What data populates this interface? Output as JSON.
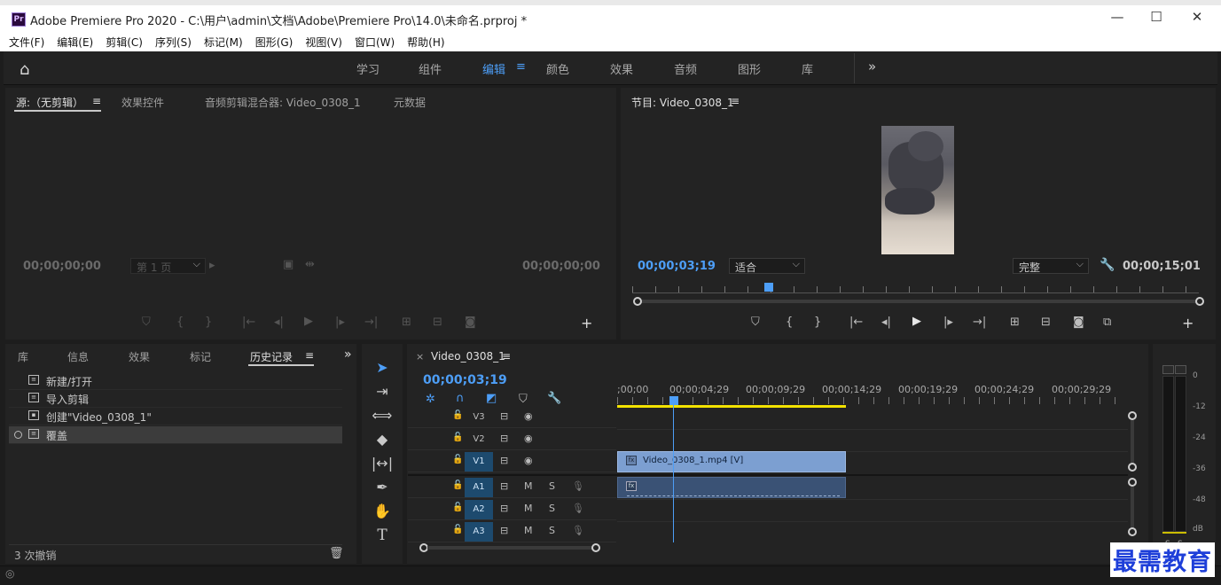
{
  "window": {
    "title": "Adobe Premiere Pro 2020 - C:\\用户\\admin\\文档\\Adobe\\Premiere Pro\\14.0\\未命名.prproj *",
    "app_icon": "Pr",
    "minimize": "—",
    "maximize": "☐",
    "close": "✕"
  },
  "menu": [
    "文件(F)",
    "编辑(E)",
    "剪辑(C)",
    "序列(S)",
    "标记(M)",
    "图形(G)",
    "视图(V)",
    "窗口(W)",
    "帮助(H)"
  ],
  "workspaces": {
    "tabs": [
      "学习",
      "组件",
      "编辑",
      "颜色",
      "效果",
      "音频",
      "图形",
      "库"
    ],
    "active": "编辑",
    "more": "»",
    "menu_glyph": "≡"
  },
  "source_panel": {
    "tabs": [
      "源:（无剪辑）",
      "效果控件",
      "音频剪辑混合器: Video_0308_1",
      "元数据"
    ],
    "menu_glyph": "≡",
    "tc_left": "00;00;00;00",
    "tc_right": "00;00;00;00",
    "page": "第 1 页"
  },
  "program_panel": {
    "title": "节目: Video_0308_1",
    "menu_glyph": "≡",
    "tc_current": "00;00;03;19",
    "fit": "适合",
    "quality": "完整",
    "tc_duration": "00;00;15;01"
  },
  "project_panel": {
    "tabs": [
      "库",
      "信息",
      "效果",
      "标记",
      "历史记录"
    ],
    "active": "历史记录",
    "menu_glyph": "≡",
    "more": "»",
    "history": [
      "新建/打开",
      "导入剪辑",
      "创建\"Video_0308_1\"",
      "覆盖"
    ],
    "undo_count": "3 次撤销"
  },
  "timeline": {
    "close": "×",
    "sequence": "Video_0308_1",
    "menu_glyph": "≡",
    "tc": "00;00;03;19",
    "ruler": [
      ";00;00",
      "00;00;04;29",
      "00;00;09;29",
      "00;00;14;29",
      "00;00;19;29",
      "00;00;24;29",
      "00;00;29;29"
    ],
    "tracks": [
      {
        "name": "V3",
        "type": "video",
        "targeted": false
      },
      {
        "name": "V2",
        "type": "video",
        "targeted": false
      },
      {
        "name": "V1",
        "type": "video",
        "targeted": true
      },
      {
        "name": "A1",
        "type": "audio",
        "targeted": true
      },
      {
        "name": "A2",
        "type": "audio",
        "targeted": true
      },
      {
        "name": "A3",
        "type": "audio",
        "targeted": true
      }
    ],
    "video_clip": "Video_0308_1.mp4 [V]",
    "mute": "M",
    "solo": "S"
  },
  "meter": {
    "labels": [
      "0",
      "-12",
      "-24",
      "-36",
      "-48",
      "dB"
    ],
    "solo_buttons": [
      "S",
      "S"
    ]
  },
  "watermark": "最需教育",
  "colors": {
    "accent": "#4d9ef7",
    "clip_video": "#7c9fd1",
    "clip_audio": "#3a5275",
    "workarea": "#f2e200"
  }
}
